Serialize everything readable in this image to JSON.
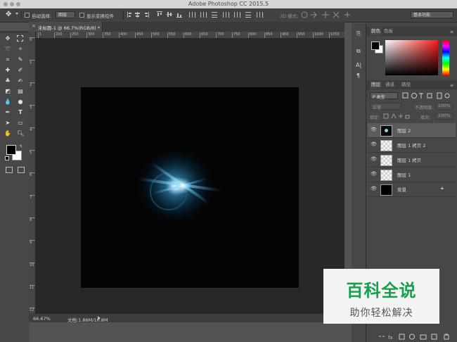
{
  "window": {
    "title": "Adobe Photoshop CC 2015.5"
  },
  "options_bar": {
    "auto_select_label": "自动选择:",
    "auto_select_value": "图层",
    "show_transform_label": "显示变换控件",
    "mode_3d_label": "3D 模式:",
    "workspace_label": "基本功能"
  },
  "document": {
    "tab_label": "未标题-1 @ 66.7%(RGB/8) *",
    "ruler_ticks_h": [
      "1",
      "200",
      "250",
      "300",
      "350",
      "400",
      "450",
      "500",
      "550",
      "600",
      "650",
      "700",
      "750",
      "800",
      "850",
      "900",
      "950",
      "1000",
      "1050"
    ],
    "ruler_ticks_v": [
      "0",
      "1",
      "2",
      "3",
      "4",
      "5",
      "6",
      "7",
      "8",
      "9",
      "10",
      "11",
      "12"
    ],
    "canvas_bg": "#040404",
    "glow_color": "#3aa8e0"
  },
  "status": {
    "zoom": "66.67%",
    "doc_info": "文档:1.86M/10.8M"
  },
  "color_panel": {
    "tabs": [
      "颜色",
      "色板"
    ],
    "hue_color": "#ff1a1a",
    "foreground": "#000000",
    "background": "#ffffff"
  },
  "layers_panel": {
    "tabs": [
      "图层",
      "通道",
      "路径"
    ],
    "filter_label": "P 类型",
    "blend_mode": "正常",
    "opacity_label": "不透明度:",
    "opacity_value": "100%",
    "lock_label": "锁定:",
    "fill_label": "填充:",
    "fill_value": "100%",
    "layers": [
      {
        "name": "图层 2",
        "type": "glow"
      },
      {
        "name": "图层 1 拷贝 2",
        "type": "transparent"
      },
      {
        "name": "图层 1 拷贝",
        "type": "transparent"
      },
      {
        "name": "图层 1",
        "type": "transparent"
      },
      {
        "name": "背景",
        "type": "background"
      }
    ]
  },
  "watermark": {
    "title": "百科全说",
    "subtitle": "助你轻松解决"
  }
}
